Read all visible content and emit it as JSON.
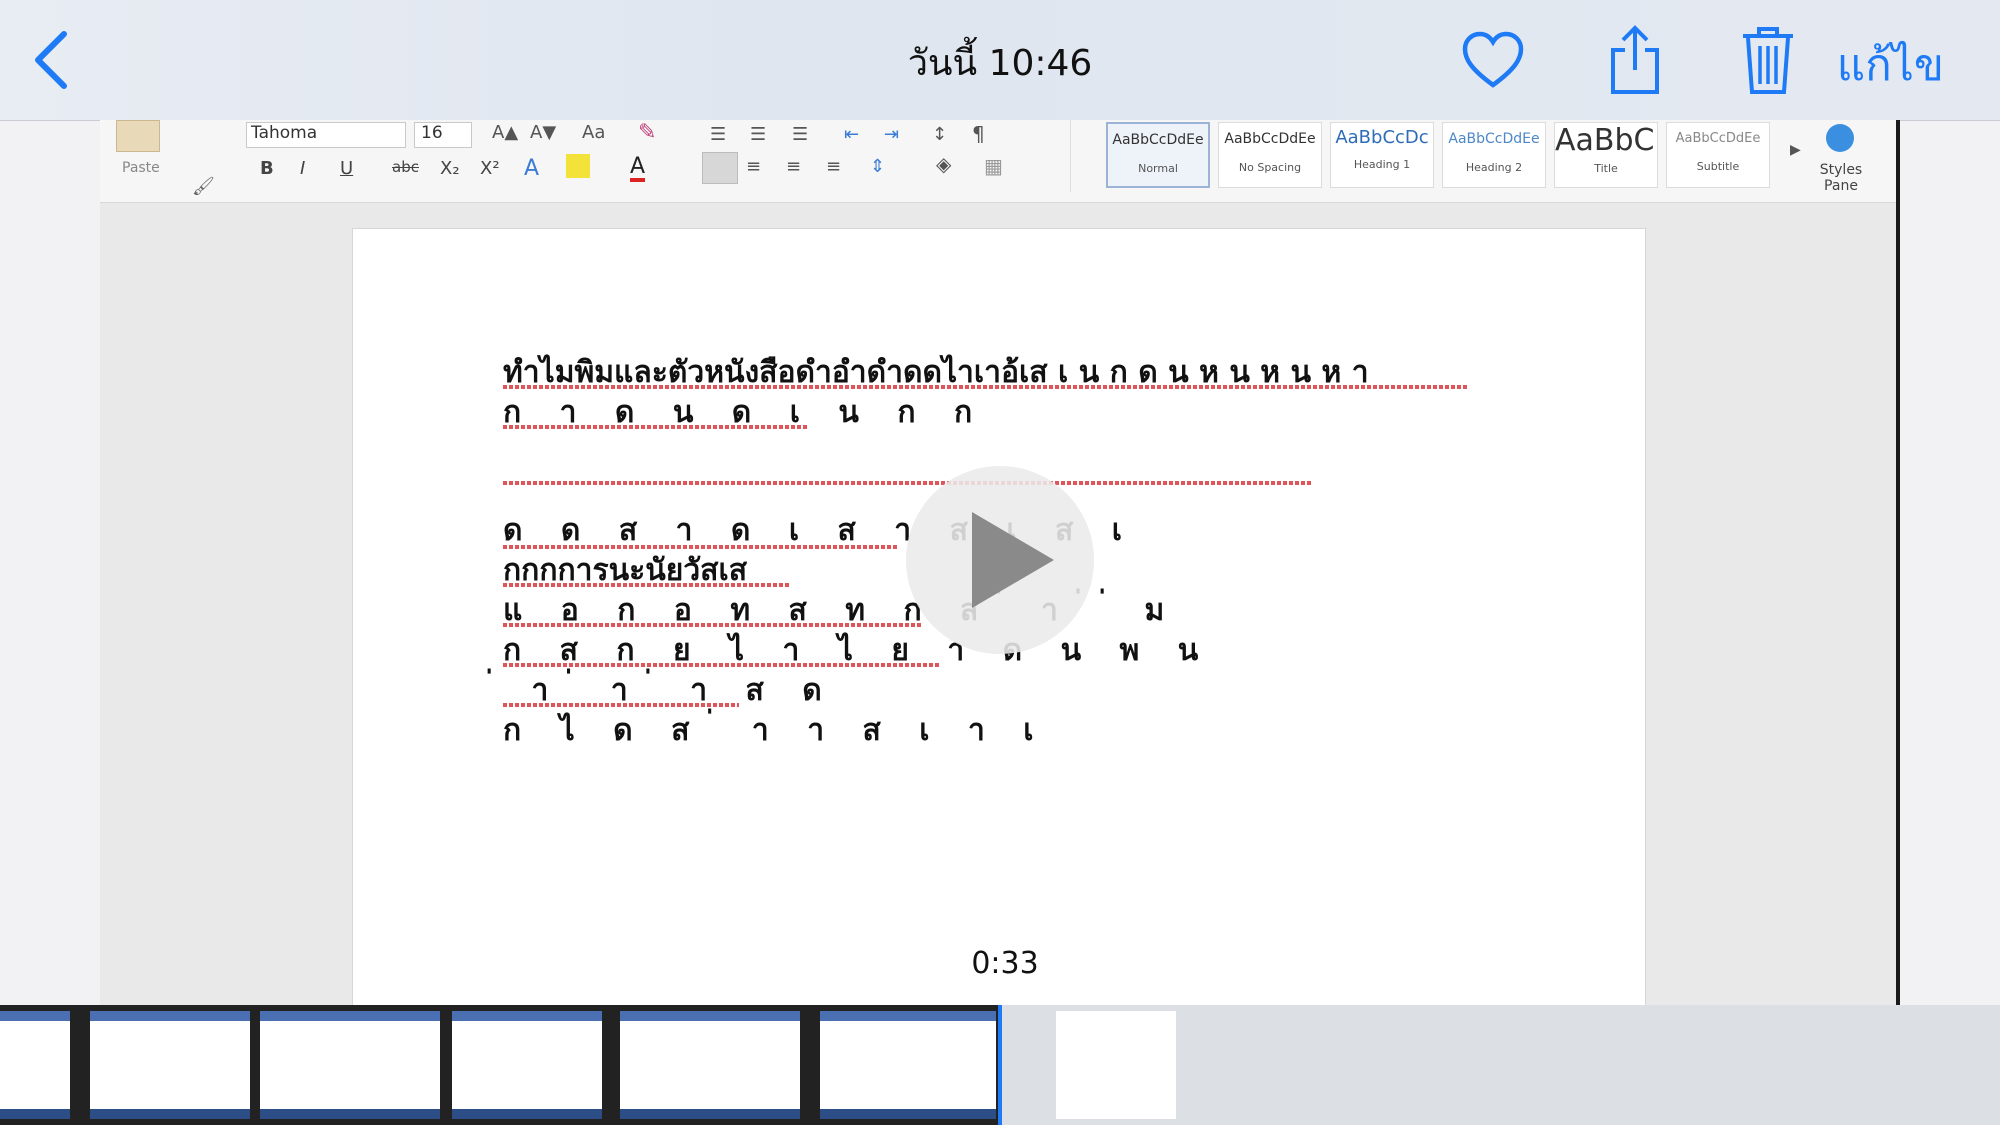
{
  "nav": {
    "title": "วันนี้ 10:46",
    "edit_label": "แก้ไข",
    "accent": "#1f7af5"
  },
  "ribbon": {
    "font_name": "Tahoma",
    "font_size": "16",
    "paste_label": "Paste",
    "format_buttons": [
      "B",
      "I",
      "U",
      "abc",
      "X₂",
      "X²"
    ],
    "styles": [
      {
        "sample": "AaBbCcDdEe",
        "name": "Normal"
      },
      {
        "sample": "AaBbCcDdEe",
        "name": "No Spacing"
      },
      {
        "sample": "AaBbCcDc",
        "name": "Heading 1"
      },
      {
        "sample": "AaBbCcDdEe",
        "name": "Heading 2"
      },
      {
        "sample": "AaBbC(",
        "name": "Title"
      },
      {
        "sample": "AaBbCcDdEe",
        "name": "Subtitle"
      }
    ],
    "styles_pane_label": "Styles Pane"
  },
  "document": {
    "lines": [
      "ทำไมพิมและตัวหนังสือดำอำดำดดไาเาอ้เส เ น ก ด น ห น ห น ห า",
      "ก า ด น ด เ น ก ก",
      "",
      "ด ด ส า ด เ ส า ส เ ส เ",
      "กกกการนะนัยวัสเส",
      "แ อ ก อ ท ส ท ก ส ่ า ่ ่ ม",
      "ก ส ก ย ไ า ไ ย า ด น พ น",
      "่ า ่ า ่ า ส ด",
      "ก ไ ด ส ่ า า ส เ า เ"
    ]
  },
  "video": {
    "timestamp": "0:33"
  }
}
